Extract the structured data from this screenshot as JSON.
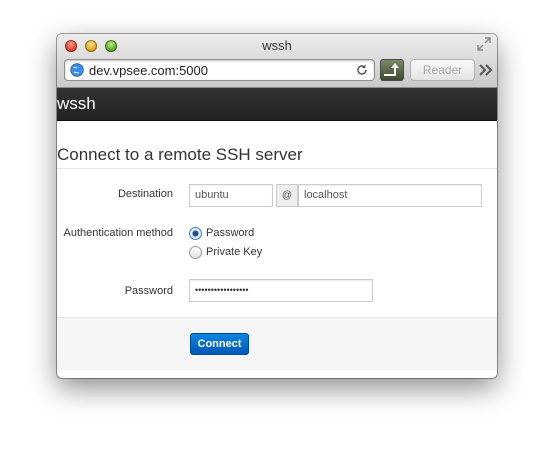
{
  "browser": {
    "window_title": "wssh",
    "url": "dev.vpsee.com:5000",
    "reader_label": "Reader",
    "icons": {
      "traffic_lights": [
        "close-icon",
        "minimize-icon",
        "zoom-icon"
      ],
      "fullscreen": "fullscreen-icon",
      "site": "globe-icon",
      "reload": "reload-icon",
      "bookmark": "bookmark-icon",
      "overflow": "double-chevron-icon"
    },
    "colors": {
      "close": "#e0443e",
      "minimize": "#dea123",
      "zoom": "#5ba532"
    }
  },
  "navbar": {
    "brand": "wssh",
    "background": "#222222"
  },
  "form": {
    "legend": "Connect to a remote SSH server",
    "destination": {
      "label": "Destination",
      "user_value": "ubuntu",
      "separator": "@",
      "host_value": "localhost"
    },
    "auth": {
      "label": "Authentication method",
      "options": [
        {
          "label": "Password",
          "selected": true
        },
        {
          "label": "Private Key",
          "selected": false
        }
      ]
    },
    "password": {
      "label": "Password",
      "masked_value": "•••••••••••••••••"
    },
    "submit_label": "Connect",
    "submit_color": "#0074cc"
  }
}
